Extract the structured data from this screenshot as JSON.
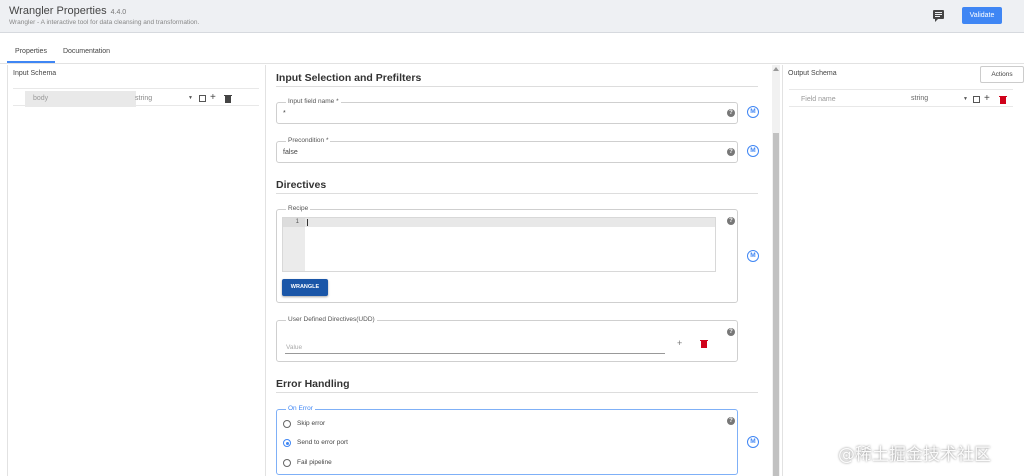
{
  "header": {
    "title": "Wrangler Properties",
    "version": "4.4.0",
    "subtitle": "Wrangler - A interactive tool for data cleansing and transformation.",
    "validate_label": "Validate"
  },
  "tabs": [
    {
      "label": "Properties",
      "active": true
    },
    {
      "label": "Documentation",
      "active": false
    }
  ],
  "input_schema": {
    "title": "Input Schema",
    "field_name": "body",
    "field_type": "string"
  },
  "output_schema": {
    "title": "Output Schema",
    "actions_label": "Actions",
    "field_placeholder": "Field name",
    "field_type": "string"
  },
  "input_selection": {
    "heading": "Input Selection and Prefilters",
    "input_field": {
      "label": "Input field name",
      "required_mark": "*",
      "value": "*"
    },
    "precondition": {
      "label": "Precondition",
      "required_mark": "*",
      "value": "false"
    }
  },
  "directives": {
    "heading": "Directives",
    "recipe": {
      "label": "Recipe",
      "line_number": "1",
      "content": ""
    },
    "wrangle_label": "WRANGLE",
    "udd": {
      "label": "User Defined Directives(UDD)",
      "placeholder": "Value"
    }
  },
  "error_handling": {
    "heading": "Error Handling",
    "on_error": {
      "label": "On Error",
      "options": [
        {
          "label": "Skip error",
          "selected": false
        },
        {
          "label": "Send to error port",
          "selected": true
        },
        {
          "label": "Fail pipeline",
          "selected": false
        }
      ]
    }
  },
  "icons": {
    "help": "?",
    "macro": "M",
    "plus": "+"
  },
  "colors": {
    "accent": "#3f86f4",
    "wrangle": "#1a56a8",
    "delete": "#d0021b"
  },
  "watermark": "@稀土掘金技术社区"
}
